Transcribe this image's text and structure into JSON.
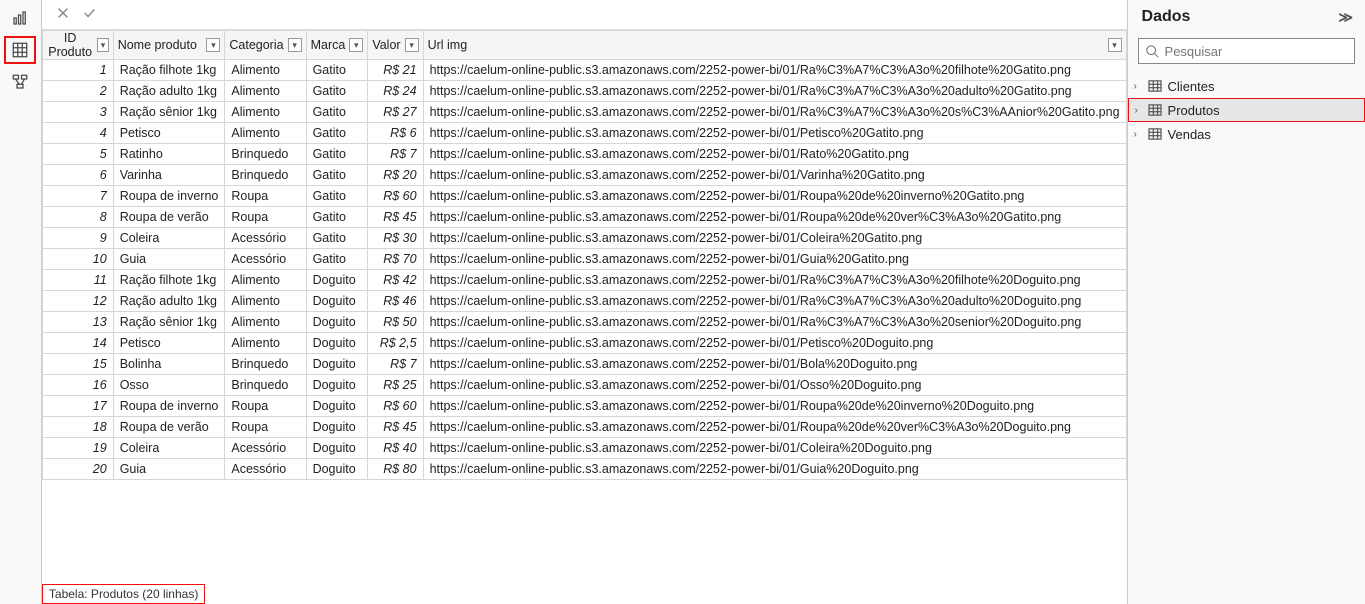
{
  "dados_panel": {
    "title": "Dados",
    "search_placeholder": "Pesquisar",
    "tables": [
      {
        "name": "Clientes",
        "selected": false
      },
      {
        "name": "Produtos",
        "selected": true
      },
      {
        "name": "Vendas",
        "selected": false
      }
    ]
  },
  "status_bar": "Tabela: Produtos (20 linhas)",
  "columns": [
    {
      "key": "id",
      "label": "ID Produto",
      "cls": "c-id",
      "numeric": true
    },
    {
      "key": "nome",
      "label": "Nome produto",
      "cls": "c-nome",
      "numeric": false
    },
    {
      "key": "cat",
      "label": "Categoria",
      "cls": "c-cat",
      "numeric": false
    },
    {
      "key": "marca",
      "label": "Marca",
      "cls": "c-marca",
      "numeric": false
    },
    {
      "key": "valor",
      "label": "Valor",
      "cls": "c-valor",
      "numeric": false,
      "valor": true
    },
    {
      "key": "url",
      "label": "Url img",
      "cls": "c-url",
      "numeric": false
    }
  ],
  "rows": [
    {
      "id": 1,
      "nome": "Ração filhote 1kg",
      "cat": "Alimento",
      "marca": "Gatito",
      "valor": "R$ 21",
      "url": "https://caelum-online-public.s3.amazonaws.com/2252-power-bi/01/Ra%C3%A7%C3%A3o%20filhote%20Gatito.png"
    },
    {
      "id": 2,
      "nome": "Ração adulto 1kg",
      "cat": "Alimento",
      "marca": "Gatito",
      "valor": "R$ 24",
      "url": "https://caelum-online-public.s3.amazonaws.com/2252-power-bi/01/Ra%C3%A7%C3%A3o%20adulto%20Gatito.png"
    },
    {
      "id": 3,
      "nome": "Ração sênior 1kg",
      "cat": "Alimento",
      "marca": "Gatito",
      "valor": "R$ 27",
      "url": "https://caelum-online-public.s3.amazonaws.com/2252-power-bi/01/Ra%C3%A7%C3%A3o%20s%C3%AAnior%20Gatito.png"
    },
    {
      "id": 4,
      "nome": "Petisco",
      "cat": "Alimento",
      "marca": "Gatito",
      "valor": "R$ 6",
      "url": "https://caelum-online-public.s3.amazonaws.com/2252-power-bi/01/Petisco%20Gatito.png"
    },
    {
      "id": 5,
      "nome": "Ratinho",
      "cat": "Brinquedo",
      "marca": "Gatito",
      "valor": "R$ 7",
      "url": "https://caelum-online-public.s3.amazonaws.com/2252-power-bi/01/Rato%20Gatito.png"
    },
    {
      "id": 6,
      "nome": "Varinha",
      "cat": "Brinquedo",
      "marca": "Gatito",
      "valor": "R$ 20",
      "url": "https://caelum-online-public.s3.amazonaws.com/2252-power-bi/01/Varinha%20Gatito.png"
    },
    {
      "id": 7,
      "nome": "Roupa de inverno",
      "cat": "Roupa",
      "marca": "Gatito",
      "valor": "R$ 60",
      "url": "https://caelum-online-public.s3.amazonaws.com/2252-power-bi/01/Roupa%20de%20inverno%20Gatito.png"
    },
    {
      "id": 8,
      "nome": "Roupa de verão",
      "cat": "Roupa",
      "marca": "Gatito",
      "valor": "R$ 45",
      "url": "https://caelum-online-public.s3.amazonaws.com/2252-power-bi/01/Roupa%20de%20ver%C3%A3o%20Gatito.png"
    },
    {
      "id": 9,
      "nome": "Coleira",
      "cat": "Acessório",
      "marca": "Gatito",
      "valor": "R$ 30",
      "url": "https://caelum-online-public.s3.amazonaws.com/2252-power-bi/01/Coleira%20Gatito.png"
    },
    {
      "id": 10,
      "nome": "Guia",
      "cat": "Acessório",
      "marca": "Gatito",
      "valor": "R$ 70",
      "url": "https://caelum-online-public.s3.amazonaws.com/2252-power-bi/01/Guia%20Gatito.png"
    },
    {
      "id": 11,
      "nome": "Ração filhote 1kg",
      "cat": "Alimento",
      "marca": "Doguito",
      "valor": "R$ 42",
      "url": "https://caelum-online-public.s3.amazonaws.com/2252-power-bi/01/Ra%C3%A7%C3%A3o%20filhote%20Doguito.png"
    },
    {
      "id": 12,
      "nome": "Ração adulto 1kg",
      "cat": "Alimento",
      "marca": "Doguito",
      "valor": "R$ 46",
      "url": "https://caelum-online-public.s3.amazonaws.com/2252-power-bi/01/Ra%C3%A7%C3%A3o%20adulto%20Doguito.png"
    },
    {
      "id": 13,
      "nome": "Ração sênior 1kg",
      "cat": "Alimento",
      "marca": "Doguito",
      "valor": "R$ 50",
      "url": "https://caelum-online-public.s3.amazonaws.com/2252-power-bi/01/Ra%C3%A7%C3%A3o%20senior%20Doguito.png"
    },
    {
      "id": 14,
      "nome": "Petisco",
      "cat": "Alimento",
      "marca": "Doguito",
      "valor": "R$ 2,5",
      "url": "https://caelum-online-public.s3.amazonaws.com/2252-power-bi/01/Petisco%20Doguito.png"
    },
    {
      "id": 15,
      "nome": "Bolinha",
      "cat": "Brinquedo",
      "marca": "Doguito",
      "valor": "R$ 7",
      "url": "https://caelum-online-public.s3.amazonaws.com/2252-power-bi/01/Bola%20Doguito.png"
    },
    {
      "id": 16,
      "nome": "Osso",
      "cat": "Brinquedo",
      "marca": "Doguito",
      "valor": "R$ 25",
      "url": "https://caelum-online-public.s3.amazonaws.com/2252-power-bi/01/Osso%20Doguito.png"
    },
    {
      "id": 17,
      "nome": "Roupa de inverno",
      "cat": "Roupa",
      "marca": "Doguito",
      "valor": "R$ 60",
      "url": "https://caelum-online-public.s3.amazonaws.com/2252-power-bi/01/Roupa%20de%20inverno%20Doguito.png"
    },
    {
      "id": 18,
      "nome": "Roupa de verão",
      "cat": "Roupa",
      "marca": "Doguito",
      "valor": "R$ 45",
      "url": "https://caelum-online-public.s3.amazonaws.com/2252-power-bi/01/Roupa%20de%20ver%C3%A3o%20Doguito.png"
    },
    {
      "id": 19,
      "nome": "Coleira",
      "cat": "Acessório",
      "marca": "Doguito",
      "valor": "R$ 40",
      "url": "https://caelum-online-public.s3.amazonaws.com/2252-power-bi/01/Coleira%20Doguito.png"
    },
    {
      "id": 20,
      "nome": "Guia",
      "cat": "Acessório",
      "marca": "Doguito",
      "valor": "R$ 80",
      "url": "https://caelum-online-public.s3.amazonaws.com/2252-power-bi/01/Guia%20Doguito.png"
    }
  ]
}
